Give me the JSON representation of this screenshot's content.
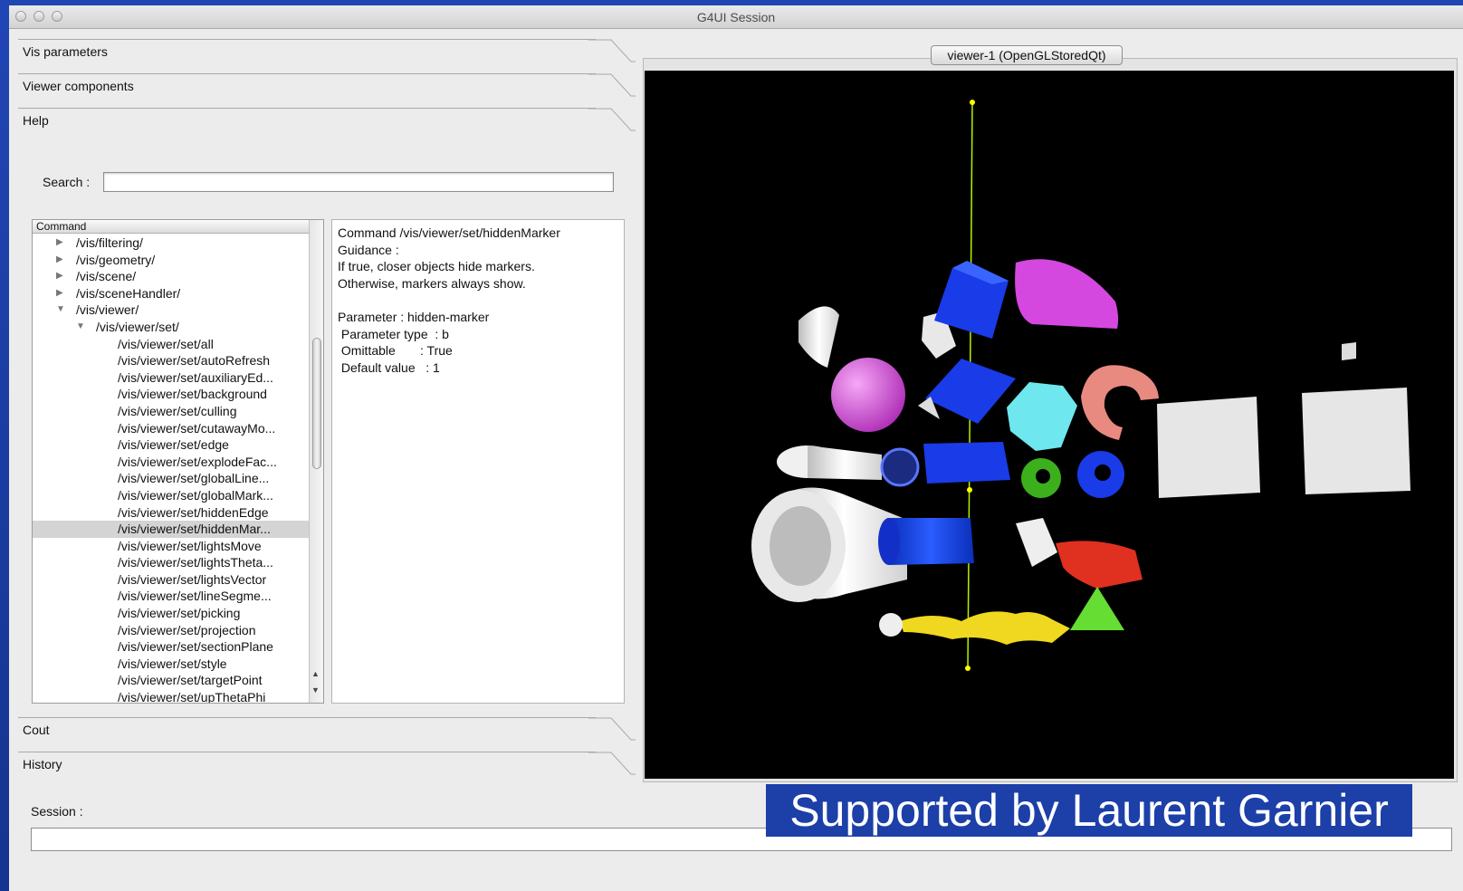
{
  "window": {
    "title": "G4UI Session"
  },
  "sections": {
    "vis_parameters": "Vis parameters",
    "viewer_components": "Viewer components",
    "help": "Help",
    "cout": "Cout",
    "history": "History"
  },
  "search": {
    "label": "Search :",
    "value": ""
  },
  "tree": {
    "header": "Command",
    "rows": [
      {
        "label": "/vis/filtering/",
        "level": 0,
        "expander": "collapsed"
      },
      {
        "label": "/vis/geometry/",
        "level": 0,
        "expander": "collapsed"
      },
      {
        "label": "/vis/scene/",
        "level": 0,
        "expander": "collapsed"
      },
      {
        "label": "/vis/sceneHandler/",
        "level": 0,
        "expander": "collapsed"
      },
      {
        "label": "/vis/viewer/",
        "level": 0,
        "expander": "expanded"
      },
      {
        "label": "/vis/viewer/set/",
        "level": 1,
        "expander": "expanded"
      },
      {
        "label": "/vis/viewer/set/all",
        "level": 2,
        "expander": "none"
      },
      {
        "label": "/vis/viewer/set/autoRefresh",
        "level": 2,
        "expander": "none"
      },
      {
        "label": "/vis/viewer/set/auxiliaryEd...",
        "level": 2,
        "expander": "none"
      },
      {
        "label": "/vis/viewer/set/background",
        "level": 2,
        "expander": "none"
      },
      {
        "label": "/vis/viewer/set/culling",
        "level": 2,
        "expander": "none"
      },
      {
        "label": "/vis/viewer/set/cutawayMo...",
        "level": 2,
        "expander": "none"
      },
      {
        "label": "/vis/viewer/set/edge",
        "level": 2,
        "expander": "none"
      },
      {
        "label": "/vis/viewer/set/explodeFac...",
        "level": 2,
        "expander": "none"
      },
      {
        "label": "/vis/viewer/set/globalLine...",
        "level": 2,
        "expander": "none"
      },
      {
        "label": "/vis/viewer/set/globalMark...",
        "level": 2,
        "expander": "none"
      },
      {
        "label": "/vis/viewer/set/hiddenEdge",
        "level": 2,
        "expander": "none"
      },
      {
        "label": "/vis/viewer/set/hiddenMar...",
        "level": 2,
        "expander": "none",
        "selected": true
      },
      {
        "label": "/vis/viewer/set/lightsMove",
        "level": 2,
        "expander": "none"
      },
      {
        "label": "/vis/viewer/set/lightsTheta...",
        "level": 2,
        "expander": "none"
      },
      {
        "label": "/vis/viewer/set/lightsVector",
        "level": 2,
        "expander": "none"
      },
      {
        "label": "/vis/viewer/set/lineSegme...",
        "level": 2,
        "expander": "none"
      },
      {
        "label": "/vis/viewer/set/picking",
        "level": 2,
        "expander": "none"
      },
      {
        "label": "/vis/viewer/set/projection",
        "level": 2,
        "expander": "none"
      },
      {
        "label": "/vis/viewer/set/sectionPlane",
        "level": 2,
        "expander": "none"
      },
      {
        "label": "/vis/viewer/set/style",
        "level": 2,
        "expander": "none"
      },
      {
        "label": "/vis/viewer/set/targetPoint",
        "level": 2,
        "expander": "none"
      },
      {
        "label": "/vis/viewer/set/upThetaPhi",
        "level": 2,
        "expander": "none"
      }
    ]
  },
  "help_text": {
    "lines": [
      "Command /vis/viewer/set/hiddenMarker",
      "Guidance :",
      "If true, closer objects hide markers.",
      "Otherwise, markers always show.",
      "",
      "Parameter : hidden-marker",
      " Parameter type  : b",
      " Omittable       : True",
      " Default value   : 1"
    ]
  },
  "session": {
    "label": "Session :",
    "value": ""
  },
  "viewer": {
    "tab_label": "viewer-1 (OpenGLStoredQt)"
  },
  "caption": "Supported by Laurent Garnier",
  "colors": {
    "desktop_blue": "#1c3fa8",
    "window_bg": "#ececec",
    "viewer_bg": "#000000",
    "selection": "#d4d4d4"
  }
}
